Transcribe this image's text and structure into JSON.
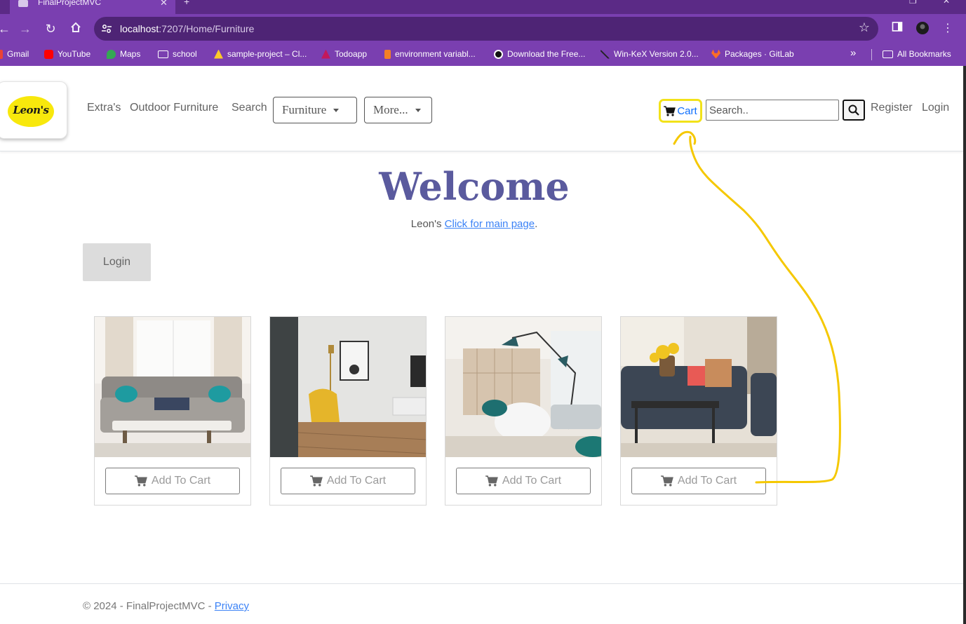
{
  "browser": {
    "tab_title": "FinalProjectMVC",
    "url_host": "localhost",
    "url_path": ":7207/Home/Furniture",
    "bookmarks": [
      {
        "label": "Gmail",
        "icon": "gmail-icon",
        "color": "#ea4335"
      },
      {
        "label": "YouTube",
        "icon": "youtube-icon",
        "color": "#ff0000"
      },
      {
        "label": "Maps",
        "icon": "maps-icon",
        "color": "#34a853"
      },
      {
        "label": "school",
        "icon": "folder-icon",
        "color": "#ffffff"
      },
      {
        "label": "sample-project – Cl...",
        "icon": "firebase-icon",
        "color": "#ffca28"
      },
      {
        "label": "Todoapp",
        "icon": "todoapp-icon",
        "color": "#c2185b"
      },
      {
        "label": "environment variabl...",
        "icon": "stackoverflow-icon",
        "color": "#f48024"
      },
      {
        "label": "Download the Free...",
        "icon": "eye-icon",
        "color": "#ffffff"
      },
      {
        "label": "Win-KeX Version 2.0...",
        "icon": "kali-icon",
        "color": "#222222"
      },
      {
        "label": "Packages · GitLab",
        "icon": "gitlab-icon",
        "color": "#fc6d26"
      }
    ],
    "more_bookmarks": "»",
    "all_bookmarks": "All Bookmarks"
  },
  "nav": {
    "logo_text": "Leon's",
    "links": [
      "Extra's",
      "Outdoor Furniture",
      "Search"
    ],
    "dropdowns": [
      "Furniture",
      "More..."
    ],
    "cart_label": "Cart",
    "search_placeholder": "Search..",
    "register": "Register",
    "login": "Login"
  },
  "main": {
    "heading": "Welcome",
    "sub_prefix": "Leon's",
    "sub_link": "Click for main page",
    "sub_suffix": ".",
    "login_button": "Login",
    "products": [
      {
        "button": "Add To Cart",
        "image": "grey-sofa-room"
      },
      {
        "button": "Add To Cart",
        "image": "yellow-armchair-room"
      },
      {
        "button": "Add To Cart",
        "image": "floor-lamp-lounge"
      },
      {
        "button": "Add To Cart",
        "image": "leather-sofa-room"
      }
    ]
  },
  "footer": {
    "text": "© 2024 - FinalProjectMVC - ",
    "privacy": "Privacy"
  },
  "colors": {
    "browser_accent": "#7a3fb0",
    "heading": "#5a5a9e",
    "link": "#3b82f6",
    "cart_highlight": "#f2e21a",
    "annotation_arrow": "#f5c800"
  }
}
